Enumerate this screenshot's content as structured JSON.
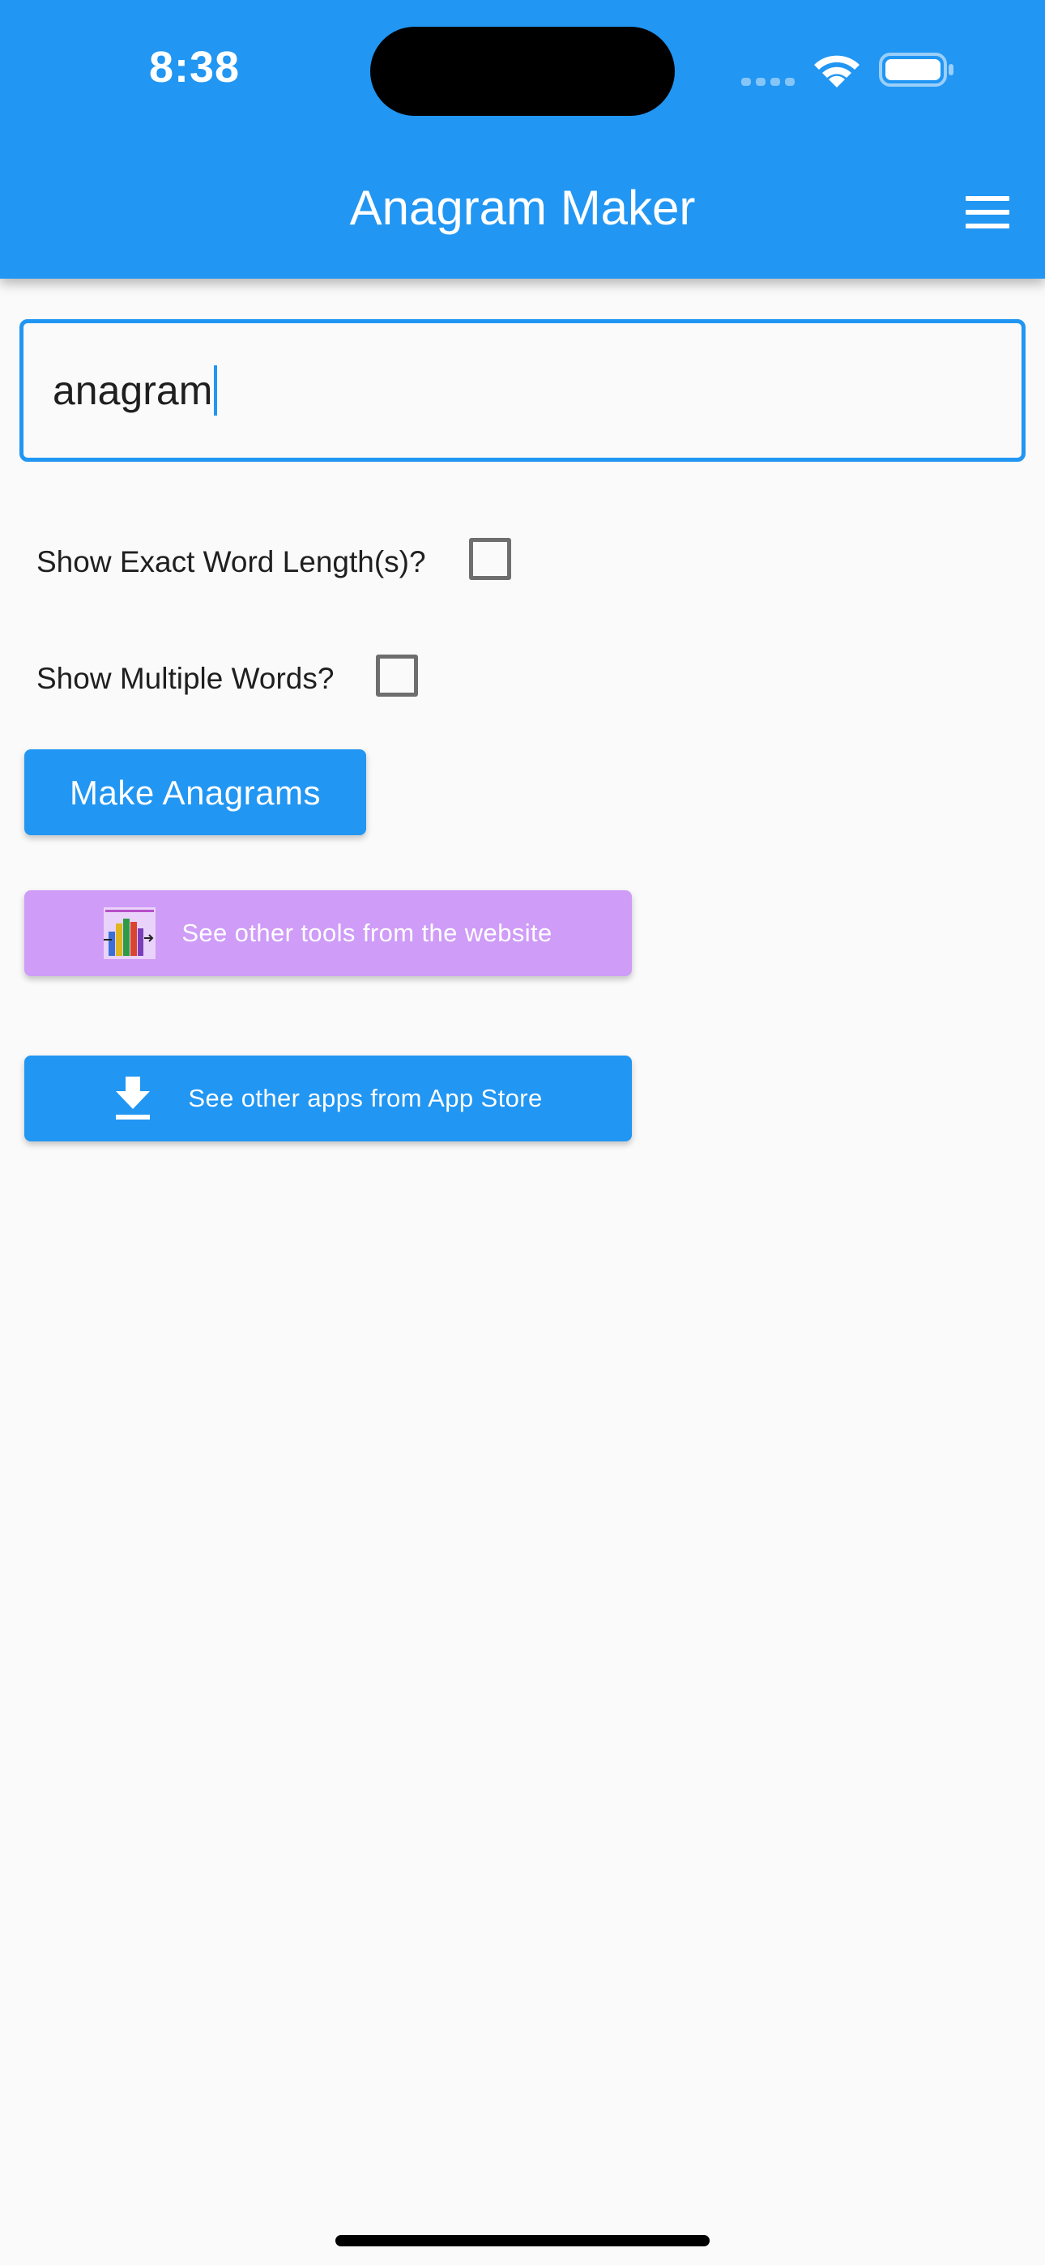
{
  "status_bar": {
    "time": "8:38"
  },
  "header": {
    "title": "Anagram Maker",
    "menu_icon": "hamburger-menu-icon",
    "background_color": "#2196f3"
  },
  "input": {
    "value": "anagram",
    "border_color": "#2196f3"
  },
  "options": {
    "exact_length_label": "Show Exact Word Length(s)?",
    "exact_length_checked": false,
    "multiple_words_label": "Show Multiple Words?",
    "multiple_words_checked": false
  },
  "buttons": {
    "make_anagrams_label": "Make Anagrams",
    "tools_label": "See other tools from the website",
    "tools_icon": "books-icon",
    "tools_color": "#cf9cf8",
    "apps_label": "See other apps from App Store",
    "apps_icon": "download-icon",
    "apps_color": "#2196f3"
  }
}
